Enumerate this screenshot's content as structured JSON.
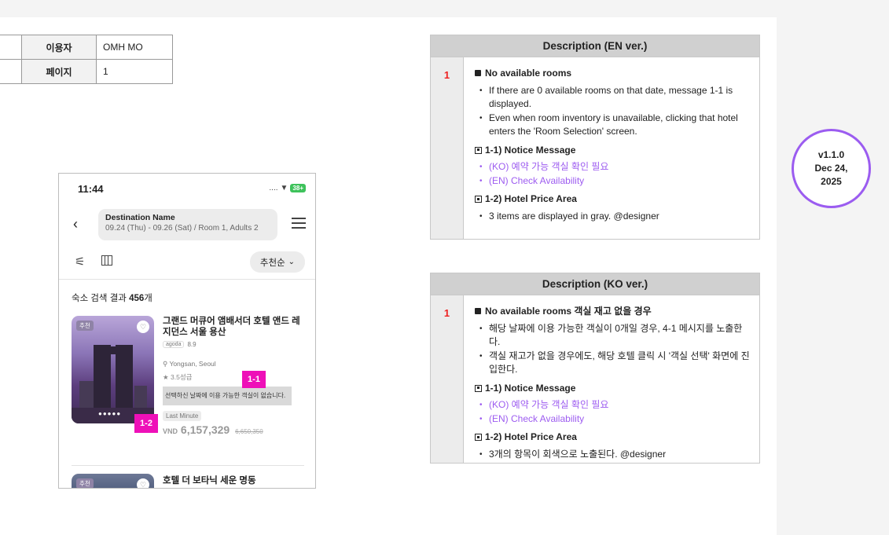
{
  "meta_table": {
    "rows": [
      {
        "key": "이용자",
        "value": "OMH MO"
      },
      {
        "key": "페이지",
        "value": "1"
      }
    ]
  },
  "phone": {
    "status_time": "11:44",
    "status_dots": "....",
    "wifi_glyph": "▼",
    "battery": "38+",
    "destination_name": "Destination Name",
    "destination_detail": "09.24 (Thu) - 09.26 (Sat) / Room 1, Adults 2",
    "back_glyph": "‹",
    "filter_glyph": "⚟",
    "sort_label": "추천순",
    "sort_chevron": "⌄",
    "result_prefix": "숙소 검색 결과 ",
    "result_count": "456",
    "result_suffix": "개",
    "hotel1": {
      "tag": "추천",
      "heart": "♡",
      "dots": "●●●●●",
      "name": "그랜드 머큐어 앰배서더 호텔 앤드 레지던스 서울 용산",
      "agoda_logo": "agoda",
      "rating": "8.9",
      "location": "Yongsan, Seoul",
      "star_glyph": "★",
      "stars": "3.5성급",
      "notice": "선택하신 날짜에 이용 가능한 객실이 없습니다.",
      "last_minute": "Last Minute",
      "currency": "VND",
      "price": "6,157,329",
      "old_price": "6,650,350"
    },
    "hotel2": {
      "tag": "추천",
      "heart": "♡",
      "name": "호텔 더 보타닉 세운 명동"
    }
  },
  "badges": {
    "b11": "1-1",
    "b12": "1-2"
  },
  "desc_en": {
    "title": "Description (EN ver.)",
    "num": "1",
    "heading": "No available rooms",
    "bullets": [
      "If there are 0 available rooms on that date, message 1-1 is displayed.",
      "Even when room inventory is unavailable, clicking that hotel enters the 'Room Selection' screen."
    ],
    "sec1": "1-1) Notice Message",
    "sec1_items": [
      "(KO) 예약 가능 객실 확인 필요",
      "(EN) Check Availability"
    ],
    "sec2": "1-2) Hotel Price Area",
    "sec2_items": [
      "3 items are displayed in gray. @designer"
    ]
  },
  "desc_ko": {
    "title": "Description (KO ver.)",
    "num": "1",
    "heading": "No available rooms 객실 재고 없을 경우",
    "bullets": [
      "해당 날짜에 이용 가능한 객실이 0개일 경우, 4-1 메시지를 노출한다.",
      "객실 재고가 없을 경우에도, 해당 호텔 클릭 시 '객실 선택' 화면에 진입한다."
    ],
    "sec1": "1-1) Notice Message",
    "sec1_items": [
      "(KO) 예약 가능 객실 확인 필요",
      "(EN) Check Availability"
    ],
    "sec2": "1-2) Hotel Price Area",
    "sec2_items": [
      "3개의 항목이 회색으로 노출된다. @designer"
    ]
  },
  "version": {
    "ver": "v1.1.0",
    "date1": "Dec 24,",
    "date2": "2025"
  },
  "colors": {
    "accent_magenta": "#ee10b8",
    "accent_purple": "#9b5cf0",
    "number_red": "#e22222"
  }
}
